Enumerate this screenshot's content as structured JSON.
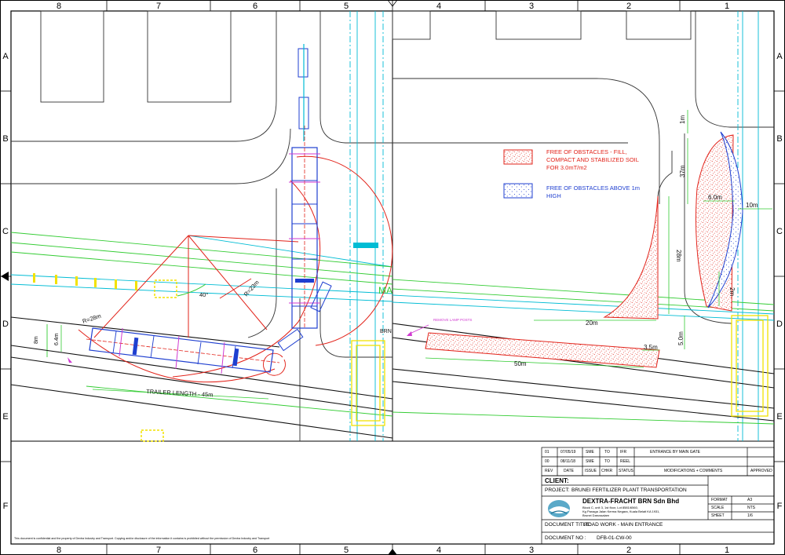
{
  "grid": {
    "columns_top": [
      "8",
      "7",
      "6",
      "5",
      "4",
      "3",
      "2",
      "1"
    ],
    "columns_bottom": [
      "8",
      "7",
      "6",
      "5",
      "4",
      "3",
      "2",
      "1"
    ],
    "rows_left": [
      "A",
      "B",
      "C",
      "D",
      "E",
      "F"
    ],
    "rows_right": [
      "A",
      "B",
      "C",
      "D",
      "E",
      "F"
    ]
  },
  "legend": {
    "fill_text": "FREE OF OBSTACLES - FILL, COMPACT AND STABILIZED SOIL FOR 3.0mT/m2",
    "fill_lines": [
      "FREE OF OBSTACLES - FILL,",
      "COMPACT AND STABILIZED SOIL",
      "FOR 3.0mT/m2"
    ],
    "above_lines": [
      "FREE OF OBSTACLES ABOVE 1m",
      "HIGH"
    ],
    "colors": {
      "fill": "#e2231a",
      "above": "#1f3fd0"
    }
  },
  "dimensions": {
    "r28": "R=28m",
    "r23": "R=23m",
    "angle": "40°",
    "w8": "8m",
    "w64": "6.4m",
    "trailer": "TRAILER LENGTH - 45m",
    "d20": "20m",
    "d35": "3.5m",
    "d50": "50m",
    "d28": "28m",
    "d50v": "5.0m",
    "d1": "1m",
    "d37": "37m",
    "d60": "6.0m",
    "d10": "10m",
    "d2": "2m"
  },
  "annotations": {
    "remove_lamp": "REMOVE LAMP POSTS",
    "ma": "MA",
    "brn": "BRN"
  },
  "title_block": {
    "revisions": [
      {
        "rev": "01",
        "date": "07/05/19",
        "issue": "SME",
        "chkr": "TO",
        "status": "IFR",
        "comment": "ENTRANCE BY MAIN GATE"
      },
      {
        "rev": "00",
        "date": "08/11/18",
        "issue": "SME",
        "chkr": "TO",
        "status": "REEL",
        "comment": ""
      }
    ],
    "headers": {
      "rev": "REV",
      "date": "DATE",
      "issue": "ISSUE",
      "chkr": "CHKR",
      "status": "STATUS",
      "mods": "MODIFICATIONS + COMMENTS",
      "approved": "APPROVED"
    },
    "client_label": "CLIENT:",
    "project_label": "PROJECT:",
    "project": "BRUNEI FERTILIZER PLANT TRANSPORTATION",
    "company": "DEXTRA-FRACHT BRN Sdn Bhd",
    "address": [
      "Block C, unit 3, 1st floor, Lot 8581/6560,",
      "Kg Panaga Jalan Kerma Negara, Kuala Belait KA 1931,",
      "Brunei Darussalam"
    ],
    "format_label": "FORMAT",
    "format": "A3",
    "scale_label": "SCALE",
    "scale": "NTS",
    "sheet_label": "SHEET",
    "sheet": "1/6",
    "doc_title_label": "DOCUMENT TITLE:",
    "doc_title": "ROAD WORK - MAIN ENTRANCE",
    "doc_no_label": "DOCUMENT NO :",
    "doc_no": "DFB-01-CW-00",
    "confidential": "This document is confidential and the property of Dextra Industry and Transport. Copying and/or disclosure of the information it contains is prohibited without the permission of Dextra Industry and Transport"
  }
}
